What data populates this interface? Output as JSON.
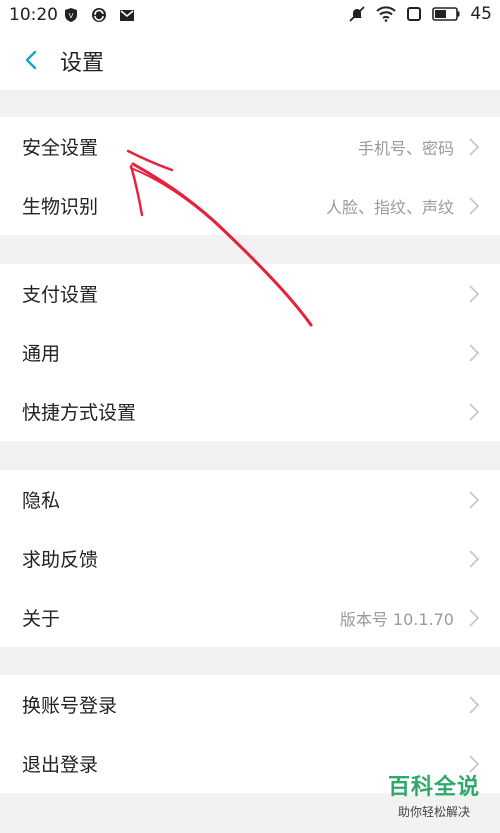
{
  "status_bar": {
    "time": "10:20",
    "battery_level": "45",
    "icons_left": [
      "shield-icon",
      "sync-icon",
      "mail-icon"
    ],
    "icons_right": [
      "mute-icon",
      "wifi-icon",
      "screen-icon",
      "battery-icon"
    ]
  },
  "header": {
    "title": "设置"
  },
  "groups": [
    {
      "items": [
        {
          "label": "安全设置",
          "value": "手机号、密码"
        },
        {
          "label": "生物识别",
          "value": "人脸、指纹、声纹"
        }
      ]
    },
    {
      "items": [
        {
          "label": "支付设置",
          "value": ""
        },
        {
          "label": "通用",
          "value": ""
        },
        {
          "label": "快捷方式设置",
          "value": ""
        }
      ]
    },
    {
      "items": [
        {
          "label": "隐私",
          "value": ""
        },
        {
          "label": "求助反馈",
          "value": ""
        },
        {
          "label": "关于",
          "value": "版本号 10.1.70"
        }
      ]
    },
    {
      "items": [
        {
          "label": "换账号登录",
          "value": ""
        },
        {
          "label": "退出登录",
          "value": ""
        }
      ]
    }
  ],
  "watermark": {
    "title": "百科全说",
    "subtitle": "助你轻松解决"
  },
  "colors": {
    "accent": "#1aa3c8",
    "arrow": "#e8203b",
    "chevron": "#c8c8c8"
  }
}
